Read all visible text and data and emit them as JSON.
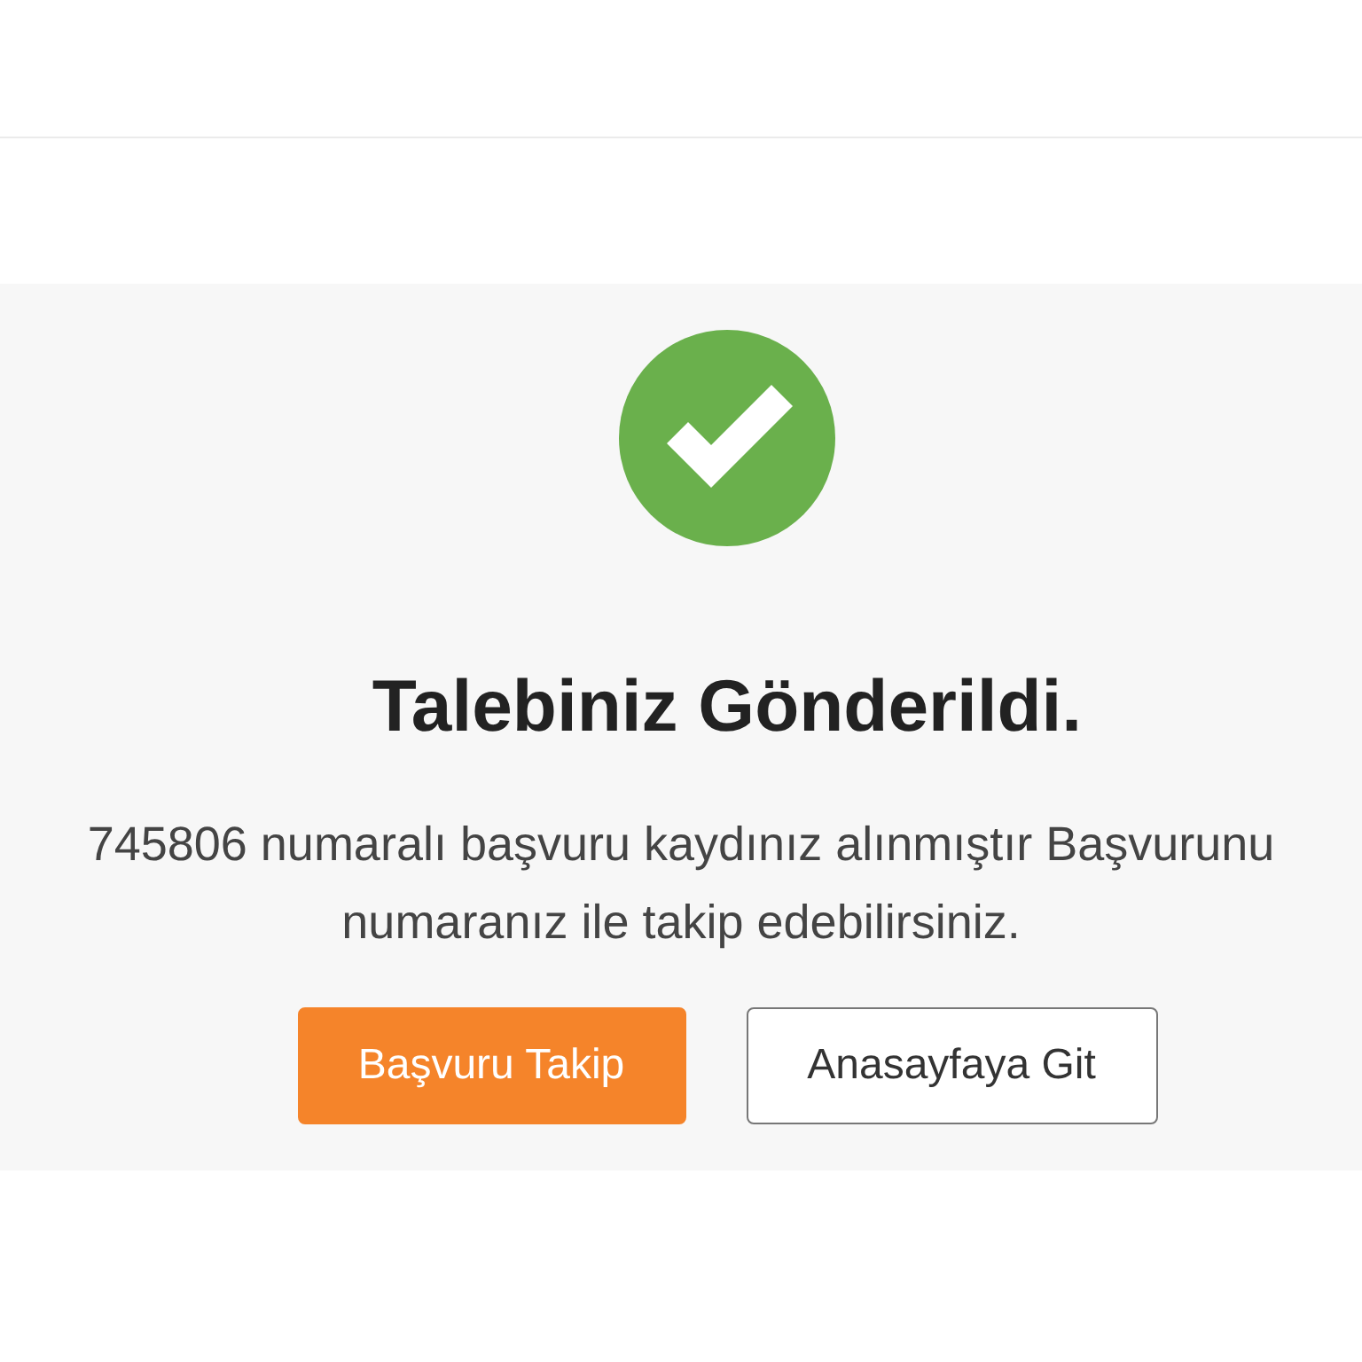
{
  "confirmation": {
    "title": "Talebiniz Gönderildi.",
    "message_lines": [
      "745806 numaralı başvuru kaydınız alınmıştır Başvurunu",
      "numaranız ile takip edebilirsiniz."
    ],
    "buttons": [
      {
        "label": "Başvuru Takip",
        "kind": "primary"
      },
      {
        "label": "Anasayfaya Git",
        "kind": "secondary"
      }
    ]
  }
}
